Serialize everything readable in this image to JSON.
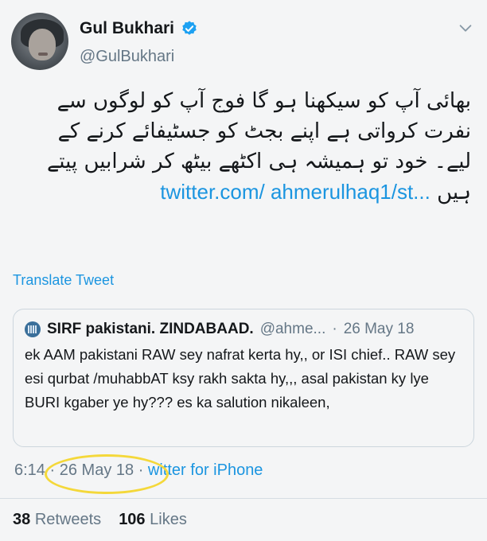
{
  "author": {
    "name": "Gul Bukhari",
    "handle": "@GulBukhari",
    "verified_color": "#1da1f2"
  },
  "tweet": {
    "text": "بھائی آپ کو سیکھنا ہو گا فوج آپ کو لوگوں سے نفرت کرواتی ہے اپنے بجٹ کو جسٹیفائے کرنے کے لیے۔ خود تو ہمیشہ ہی اکٹھے بیٹھ کر شرابیں پیتے ہیں",
    "link": "twitter.com/ ahmerulhaq1/st...",
    "translate_label": "Translate Tweet"
  },
  "quote": {
    "name": "SIRF pakistani. ZINDABAAD.",
    "handle": "@ahme...",
    "separator": "·",
    "date": "26 May 18",
    "text": "ek AAM pakistani RAW sey nafrat kerta hy,, or ISI chief.. RAW sey esi qurbat /muhabbAT ksy rakh sakta hy,,,  asal pakistan ky lye BURI kgaber ye hy??? es ka salution nikaleen,"
  },
  "meta": {
    "time": "6:14",
    "sep1": "·",
    "date": "26 May 18",
    "sep2": "·",
    "source": "witter for iPhone"
  },
  "stats": {
    "retweets_count": "38",
    "retweets_label": "Retweets",
    "likes_count": "106",
    "likes_label": "Likes"
  },
  "colors": {
    "link": "#1b95e0",
    "secondary_text": "#657786",
    "highlight_circle": "#f4d83a"
  },
  "icons": {
    "verified": "verified-badge-icon",
    "more": "chevron-down-icon"
  }
}
